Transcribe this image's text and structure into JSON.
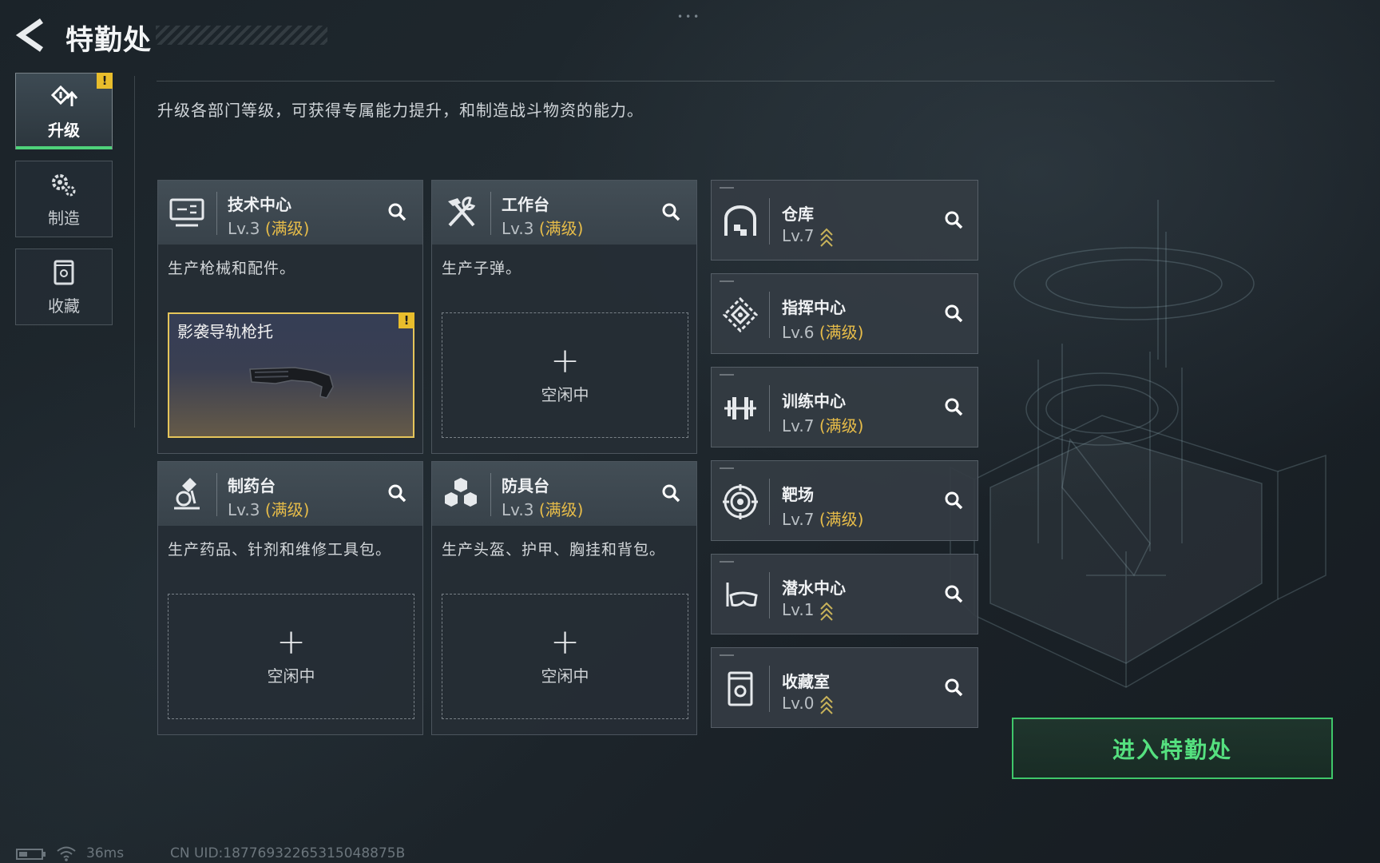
{
  "header": {
    "title": "特勤处"
  },
  "sidebar": {
    "tabs": [
      {
        "label": "升级",
        "active": true,
        "badge": "!"
      },
      {
        "label": "制造",
        "active": false
      },
      {
        "label": "收藏",
        "active": false
      }
    ]
  },
  "description": "升级各部门等级，可获得专属能力提升，和制造战斗物资的能力。",
  "facilities": [
    {
      "name": "技术中心",
      "level": "Lv.3",
      "status": "(满级)",
      "desc": "生产枪械和配件。",
      "slot": {
        "filled": true,
        "item": "影袭导轨枪托",
        "badge": "!"
      }
    },
    {
      "name": "工作台",
      "level": "Lv.3",
      "status": "(满级)",
      "desc": "生产子弹。",
      "slot": {
        "filled": false,
        "idle_text": "空闲中"
      }
    },
    {
      "name": "制药台",
      "level": "Lv.3",
      "status": "(满级)",
      "desc": "生产药品、针剂和维修工具包。",
      "slot": {
        "filled": false,
        "idle_text": "空闲中"
      }
    },
    {
      "name": "防具台",
      "level": "Lv.3",
      "status": "(满级)",
      "desc": "生产头盔、护甲、胸挂和背包。",
      "slot": {
        "filled": false,
        "idle_text": "空闲中"
      }
    }
  ],
  "departments": [
    {
      "name": "仓库",
      "level": "Lv.7",
      "status": "",
      "upgradable": true
    },
    {
      "name": "指挥中心",
      "level": "Lv.6",
      "status": "(满级)",
      "upgradable": false
    },
    {
      "name": "训练中心",
      "level": "Lv.7",
      "status": "(满级)",
      "upgradable": false
    },
    {
      "name": "靶场",
      "level": "Lv.7",
      "status": "(满级)",
      "upgradable": false
    },
    {
      "name": "潜水中心",
      "level": "Lv.1",
      "status": "",
      "upgradable": true
    },
    {
      "name": "收藏室",
      "level": "Lv.0",
      "status": "",
      "upgradable": true
    }
  ],
  "enter_button": "进入特勤处",
  "status_bar": {
    "ping": "36ms",
    "uid": "CN UID:18776932265315048875B"
  },
  "colors": {
    "accent_green": "#4fd27a",
    "max_level_gold": "#e8bd49",
    "warning_yellow": "#e8bd2c"
  }
}
